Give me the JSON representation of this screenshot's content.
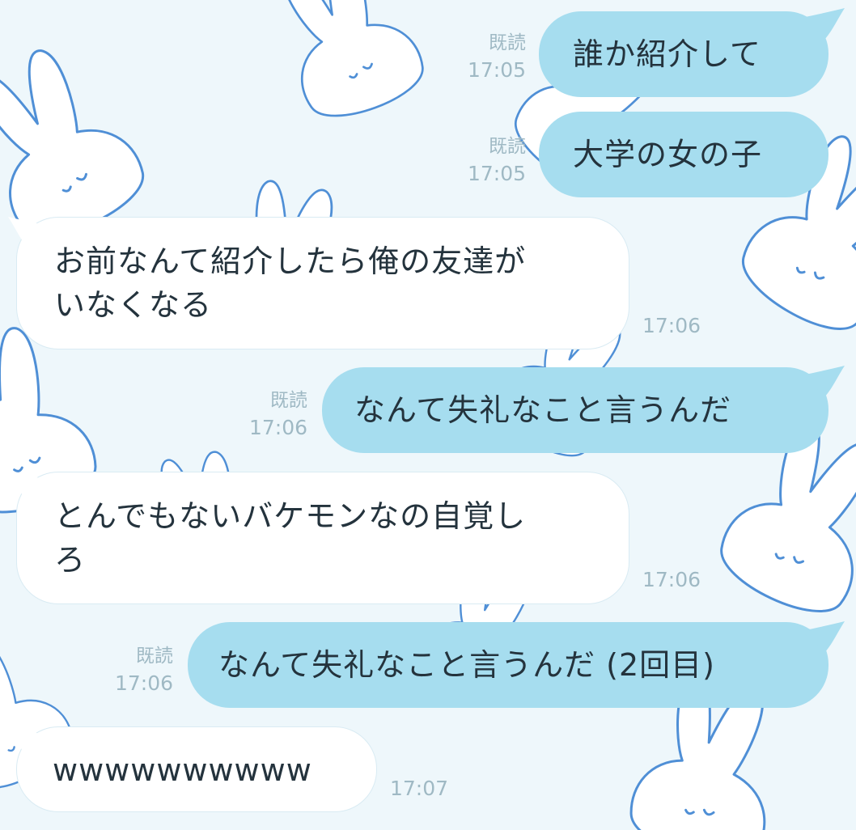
{
  "chat": {
    "messages": [
      {
        "side": "sent",
        "text": "誰か紹介して",
        "read": "既読",
        "time": "17:05"
      },
      {
        "side": "sent",
        "text": "大学の女の子",
        "read": "既読",
        "time": "17:05"
      },
      {
        "side": "received",
        "lines": [
          "お前なんて紹介したら俺の友達が",
          "いなくなる"
        ],
        "time": "17:06"
      },
      {
        "side": "sent",
        "text": "なんて失礼なこと言うんだ",
        "read": "既読",
        "time": "17:06"
      },
      {
        "side": "received",
        "lines": [
          "とんでもないバケモンなの自覚し",
          "ろ"
        ],
        "time": "17:06"
      },
      {
        "side": "sent",
        "text": "なんて失礼なこと言うんだ (2回目)",
        "read": "既読",
        "time": "17:06"
      },
      {
        "side": "received",
        "lines": [
          "wwwwwwwwww"
        ],
        "time": "17:07"
      }
    ]
  },
  "theme": {
    "sent_bubble": "#a6ddef",
    "received_bubble": "#ffffff",
    "background": "#eef7fb",
    "wallpaper": "bunny-pattern",
    "meta_text": "#9fb9c4"
  }
}
